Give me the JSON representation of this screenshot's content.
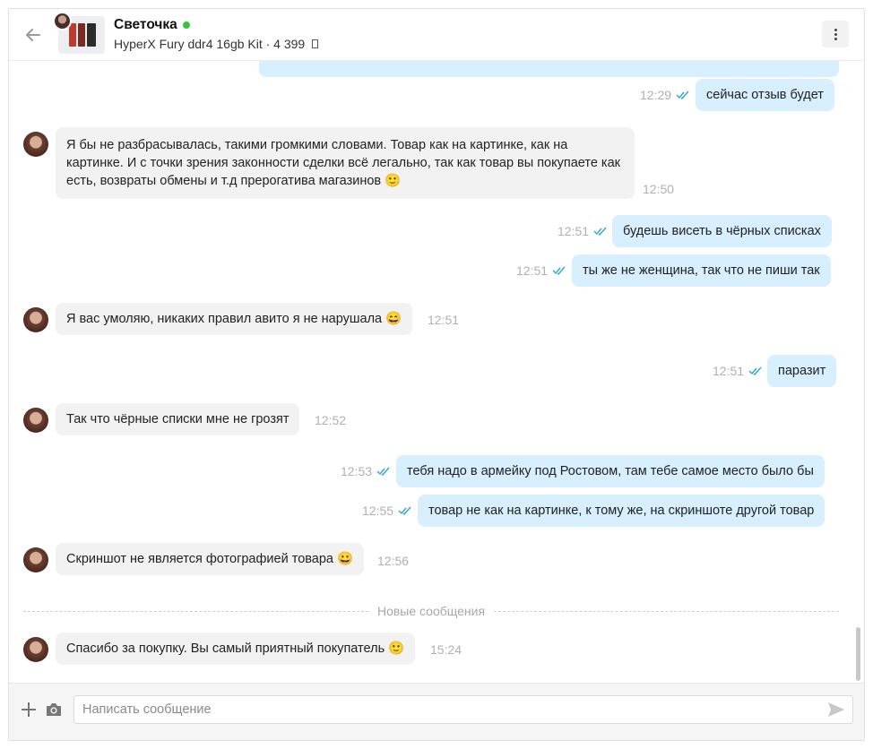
{
  "header": {
    "contact_name": "Светочка",
    "listing": "HyperX Fury ddr4 16gb Kit · 4 399"
  },
  "messages": [
    {
      "dir": "out",
      "text": "сейчас отзыв будет",
      "time": "12:29"
    },
    {
      "dir": "in",
      "text": "Я бы не разбрасывалась, такими громкими словами. Товар как на картинке, как на картинке. И с точки зрения законности сделки всё легально, так как товар вы покупаете как есть, возвраты обмены и т.д прерогатива магазинов 🙂",
      "time": "12:50"
    },
    {
      "dir": "out",
      "text": "будешь висеть в чёрных списках",
      "time": "12:51"
    },
    {
      "dir": "out",
      "text": "ты же не женщина, так что не пиши так",
      "time": "12:51"
    },
    {
      "dir": "in",
      "text": "Я вас умоляю, никаких правил авито я не нарушала 😄",
      "time": "12:51"
    },
    {
      "dir": "out",
      "text": "паразит",
      "time": "12:51"
    },
    {
      "dir": "in",
      "text": "Так что чёрные списки мне не грозят",
      "time": "12:52"
    },
    {
      "dir": "out",
      "text": "тебя надо в армейку под Ростовом, там тебе самое место было бы",
      "time": "12:53"
    },
    {
      "dir": "out",
      "text": "товар не как на картинке, к тому же, на скриншоте другой товар",
      "time": "12:55"
    },
    {
      "dir": "in",
      "text": "Скриншот не является фотографией товара 😀",
      "time": "12:56"
    },
    {
      "dir": "in",
      "text": "Спасибо за покупку. Вы самый приятный покупатель 🙂",
      "time": "15:24"
    }
  ],
  "divider_label": "Новые сообщения",
  "composer": {
    "placeholder": "Написать сообщение"
  },
  "colors": {
    "outgoing_bubble": "#d7efff",
    "incoming_bubble": "#f2f2f2",
    "online": "#35c43b",
    "read_ticks": "#2aa6d8"
  },
  "icons": [
    "back-arrow-icon",
    "more-vertical-icon",
    "plus-icon",
    "camera-icon",
    "send-icon",
    "double-check-icon"
  ]
}
